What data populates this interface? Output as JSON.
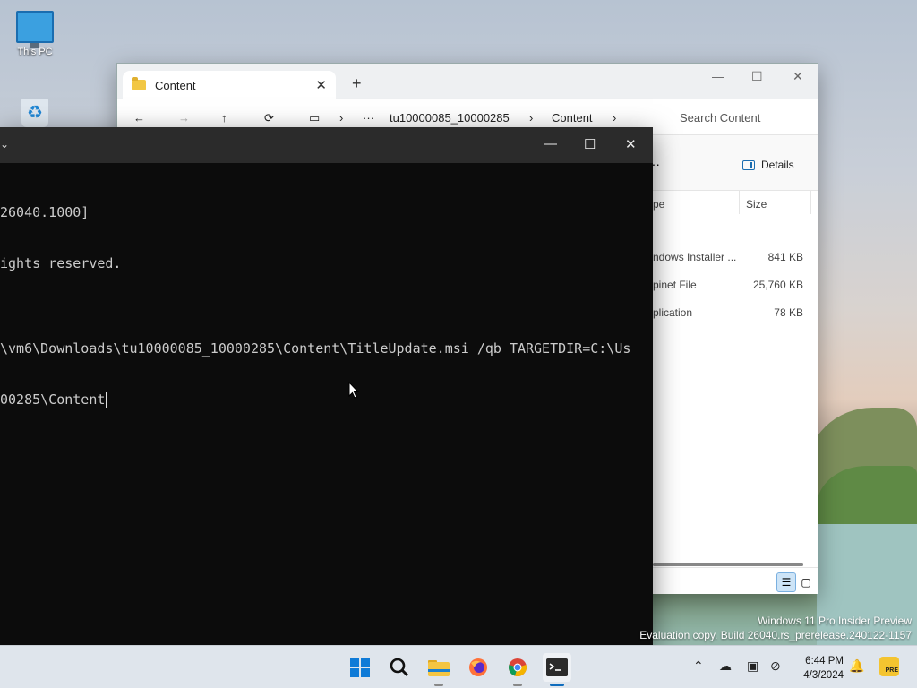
{
  "desktop": {
    "icons": [
      {
        "label": "This PC"
      },
      {
        "label": ""
      }
    ]
  },
  "explorer": {
    "tab_title": "Content",
    "tab_close": "✕",
    "new_tab": "+",
    "window_controls": {
      "minimize": "—",
      "maximize": "☐",
      "close": "✕"
    },
    "nav": {
      "back": "←",
      "forward": "→",
      "up": "↑",
      "refresh": "⟳",
      "more": "···",
      "breadcrumb": [
        "tu10000085_10000285",
        "Content"
      ],
      "search_placeholder": "Search Content"
    },
    "cmdbar": {
      "more": "···",
      "details_label": "Details"
    },
    "columns": {
      "type_partial": "pe",
      "size": "Size"
    },
    "rows": [
      {
        "type_partial": "ndows Installer ...",
        "size": "841 KB"
      },
      {
        "type_partial": "pinet File",
        "size": "25,760 KB"
      },
      {
        "type_partial": "plication",
        "size": "78 KB"
      }
    ]
  },
  "terminal": {
    "title_partial": "⌄",
    "window_controls": {
      "minimize": "—",
      "maximize": "☐",
      "close": "✕"
    },
    "lines": [
      "26040.1000]",
      "ights reserved.",
      "",
      "\\vm6\\Downloads\\tu10000085_10000285\\Content\\TitleUpdate.msi /qb TARGETDIR=C:\\Us",
      "00285\\Content"
    ]
  },
  "watermark": {
    "line1": "Windows 11 Pro Insider Preview",
    "line2": "Evaluation copy. Build 26040.rs_prerelease.240122-1157"
  },
  "taskbar": {
    "apps": [
      "start",
      "search",
      "file-explorer",
      "firefox",
      "chrome",
      "terminal"
    ],
    "clock": {
      "time": "6:44 PM",
      "date": "4/3/2024"
    },
    "tray_badge": "PRE"
  },
  "colors": {
    "accent": "#0f6cbd",
    "terminal_bg": "#0c0c0c",
    "taskbar_bg": "#dfe5ec"
  }
}
